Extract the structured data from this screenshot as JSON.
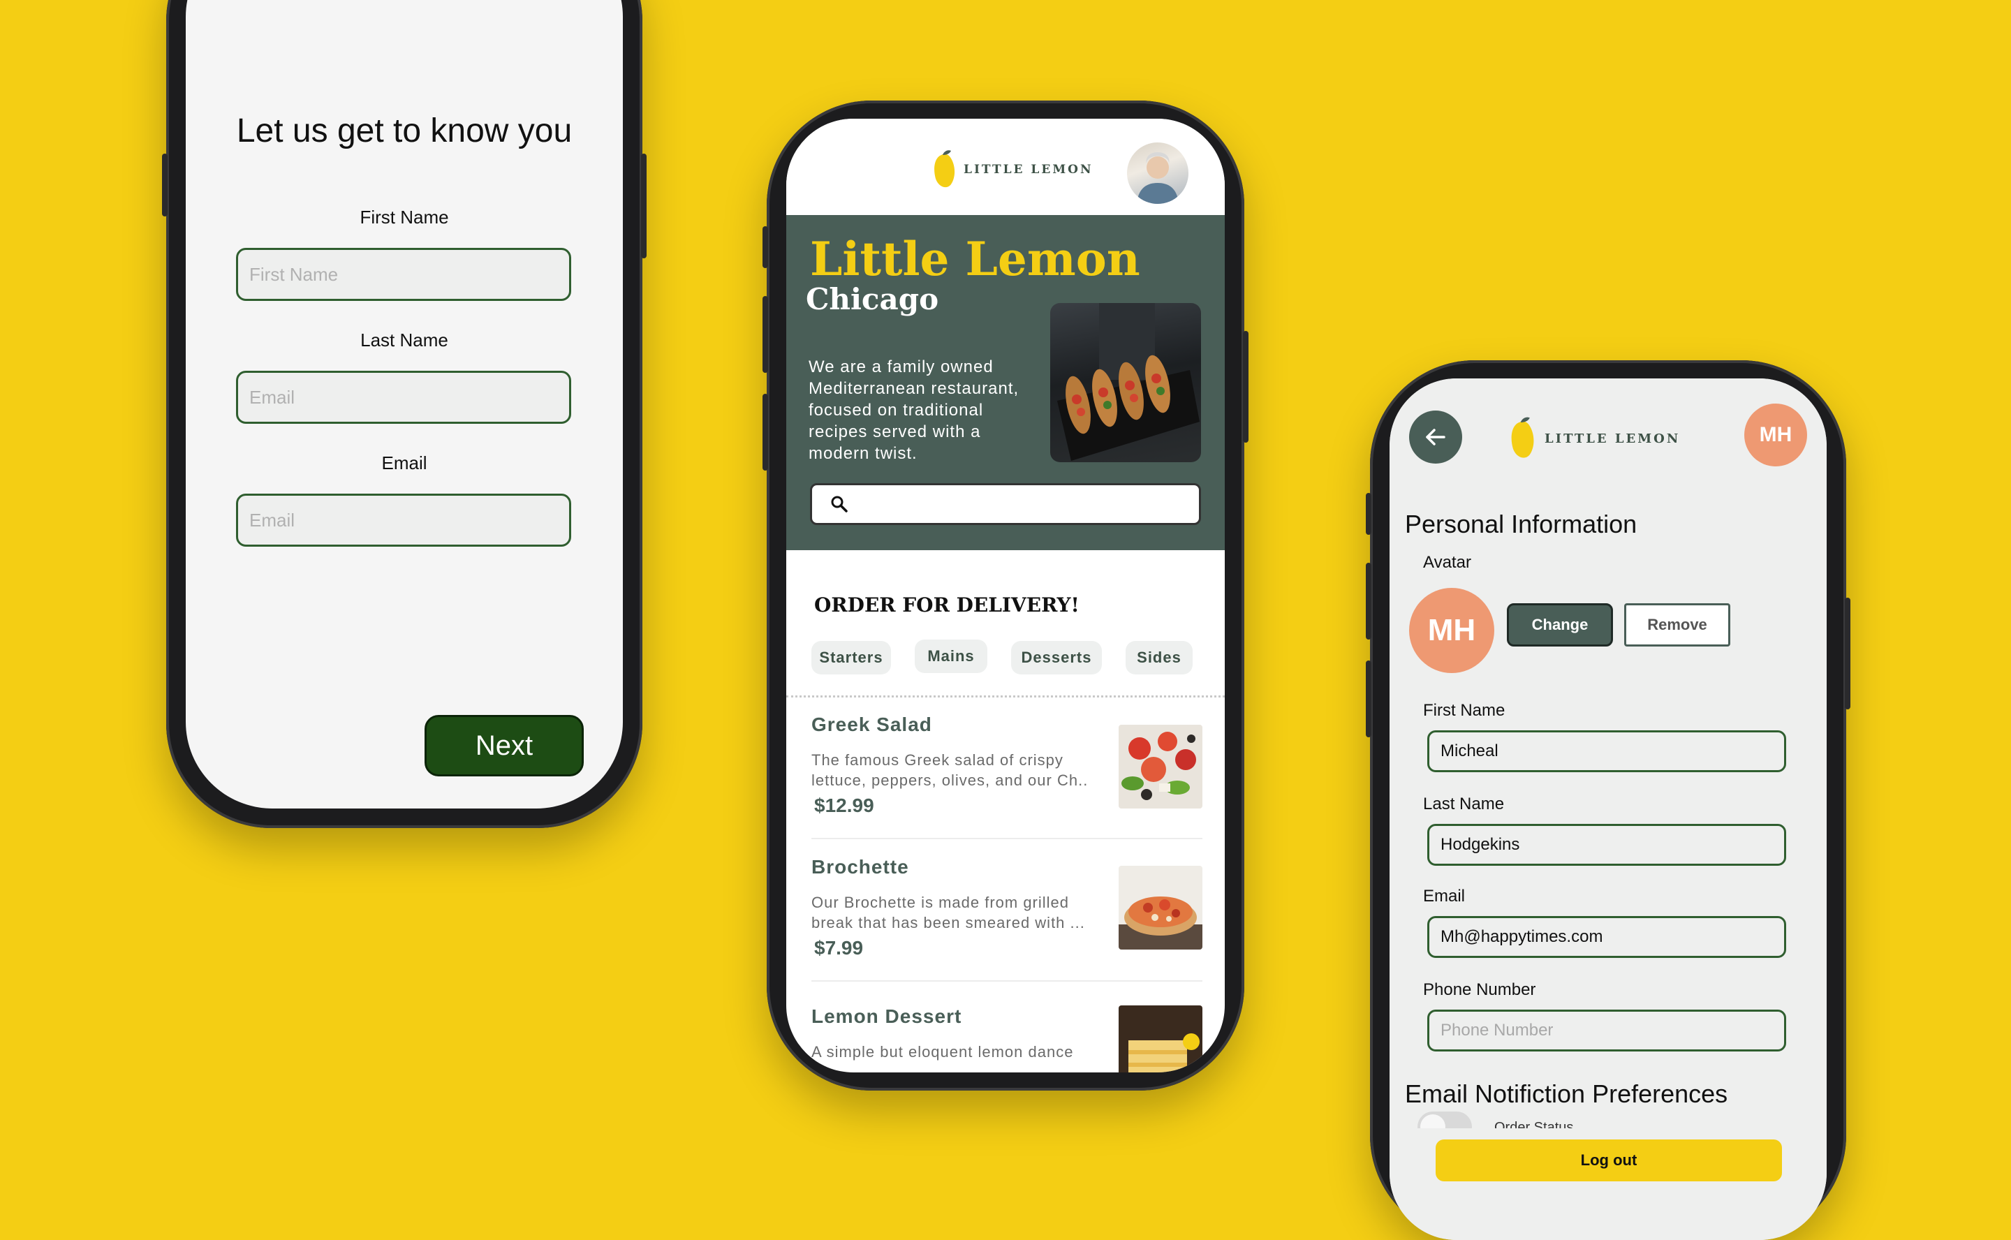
{
  "onboarding": {
    "title": "Let us get to know you",
    "first_name_label": "First Name",
    "first_name_placeholder": "First Name",
    "last_name_label": "Last Name",
    "last_name_placeholder": "Email",
    "email_label": "Email",
    "email_placeholder": "Email",
    "next_label": "Next"
  },
  "home": {
    "logo_text": "LITTLE LEMON",
    "hero_title": "Little Lemon",
    "hero_city": "Chicago",
    "hero_description": "We are a family owned Mediterranean restaurant, focused on traditional recipes served with a modern twist.",
    "search_value": "",
    "section_title": "ORDER FOR DELIVERY!",
    "categories": [
      "Starters",
      "Mains",
      "Desserts",
      "Sides"
    ],
    "menu": [
      {
        "name": "Greek Salad",
        "description": "The famous Greek salad of crispy lettuce, peppers, olives, and our Ch..",
        "price": "$12.99"
      },
      {
        "name": "Brochette",
        "description": "Our Brochette is made from grilled break that has been smeared with ...",
        "price": "$7.99"
      },
      {
        "name": "Lemon Dessert",
        "description": "A simple but eloquent lemon dance",
        "price": ""
      }
    ]
  },
  "profile": {
    "logo_text": "LITTLE LEMON",
    "avatar_initials": "MH",
    "section_title": "Personal Information",
    "avatar_label": "Avatar",
    "change_label": "Change",
    "remove_label": "Remove",
    "first_name_label": "First Name",
    "first_name_value": "Micheal",
    "last_name_label": "Last Name",
    "last_name_value": "Hodgekins",
    "email_label": "Email",
    "email_value": "Mh@happytimes.com",
    "phone_label": "Phone Number",
    "phone_placeholder": "Phone Number",
    "notif_title": "Email Notifiction Preferences",
    "order_status_label": "Order Status",
    "logout_label": "Log out"
  },
  "colors": {
    "background": "#F4CE14",
    "primary_green": "#495E57",
    "accent_yellow": "#F4CE14",
    "avatar_salmon": "#EE9972",
    "next_button": "#1D4C14"
  }
}
